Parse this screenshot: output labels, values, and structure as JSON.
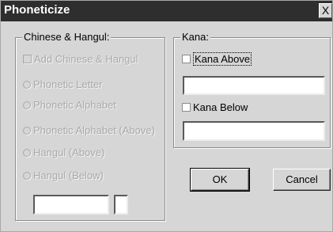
{
  "window": {
    "title": "Phoneticize",
    "close_glyph": "X"
  },
  "chinese_group": {
    "legend": "Chinese & Hangul:",
    "add_checkbox": {
      "label": "Add Chinese & Hangul",
      "checked": false,
      "enabled": false
    },
    "options": [
      "Phonetic Letter",
      "Phonetic Alphabet",
      "Phonetic Alphabet (Above)",
      "Hangul (Above)",
      "Hangul (Below)"
    ],
    "text_value": "",
    "small_value": ""
  },
  "kana_group": {
    "legend": "Kana:",
    "above_checkbox": {
      "label": "Kana Above",
      "checked": false
    },
    "above_value": "",
    "below_checkbox": {
      "label": "Kana Below",
      "checked": false
    },
    "below_value": ""
  },
  "buttons": {
    "ok": "OK",
    "cancel": "Cancel"
  }
}
